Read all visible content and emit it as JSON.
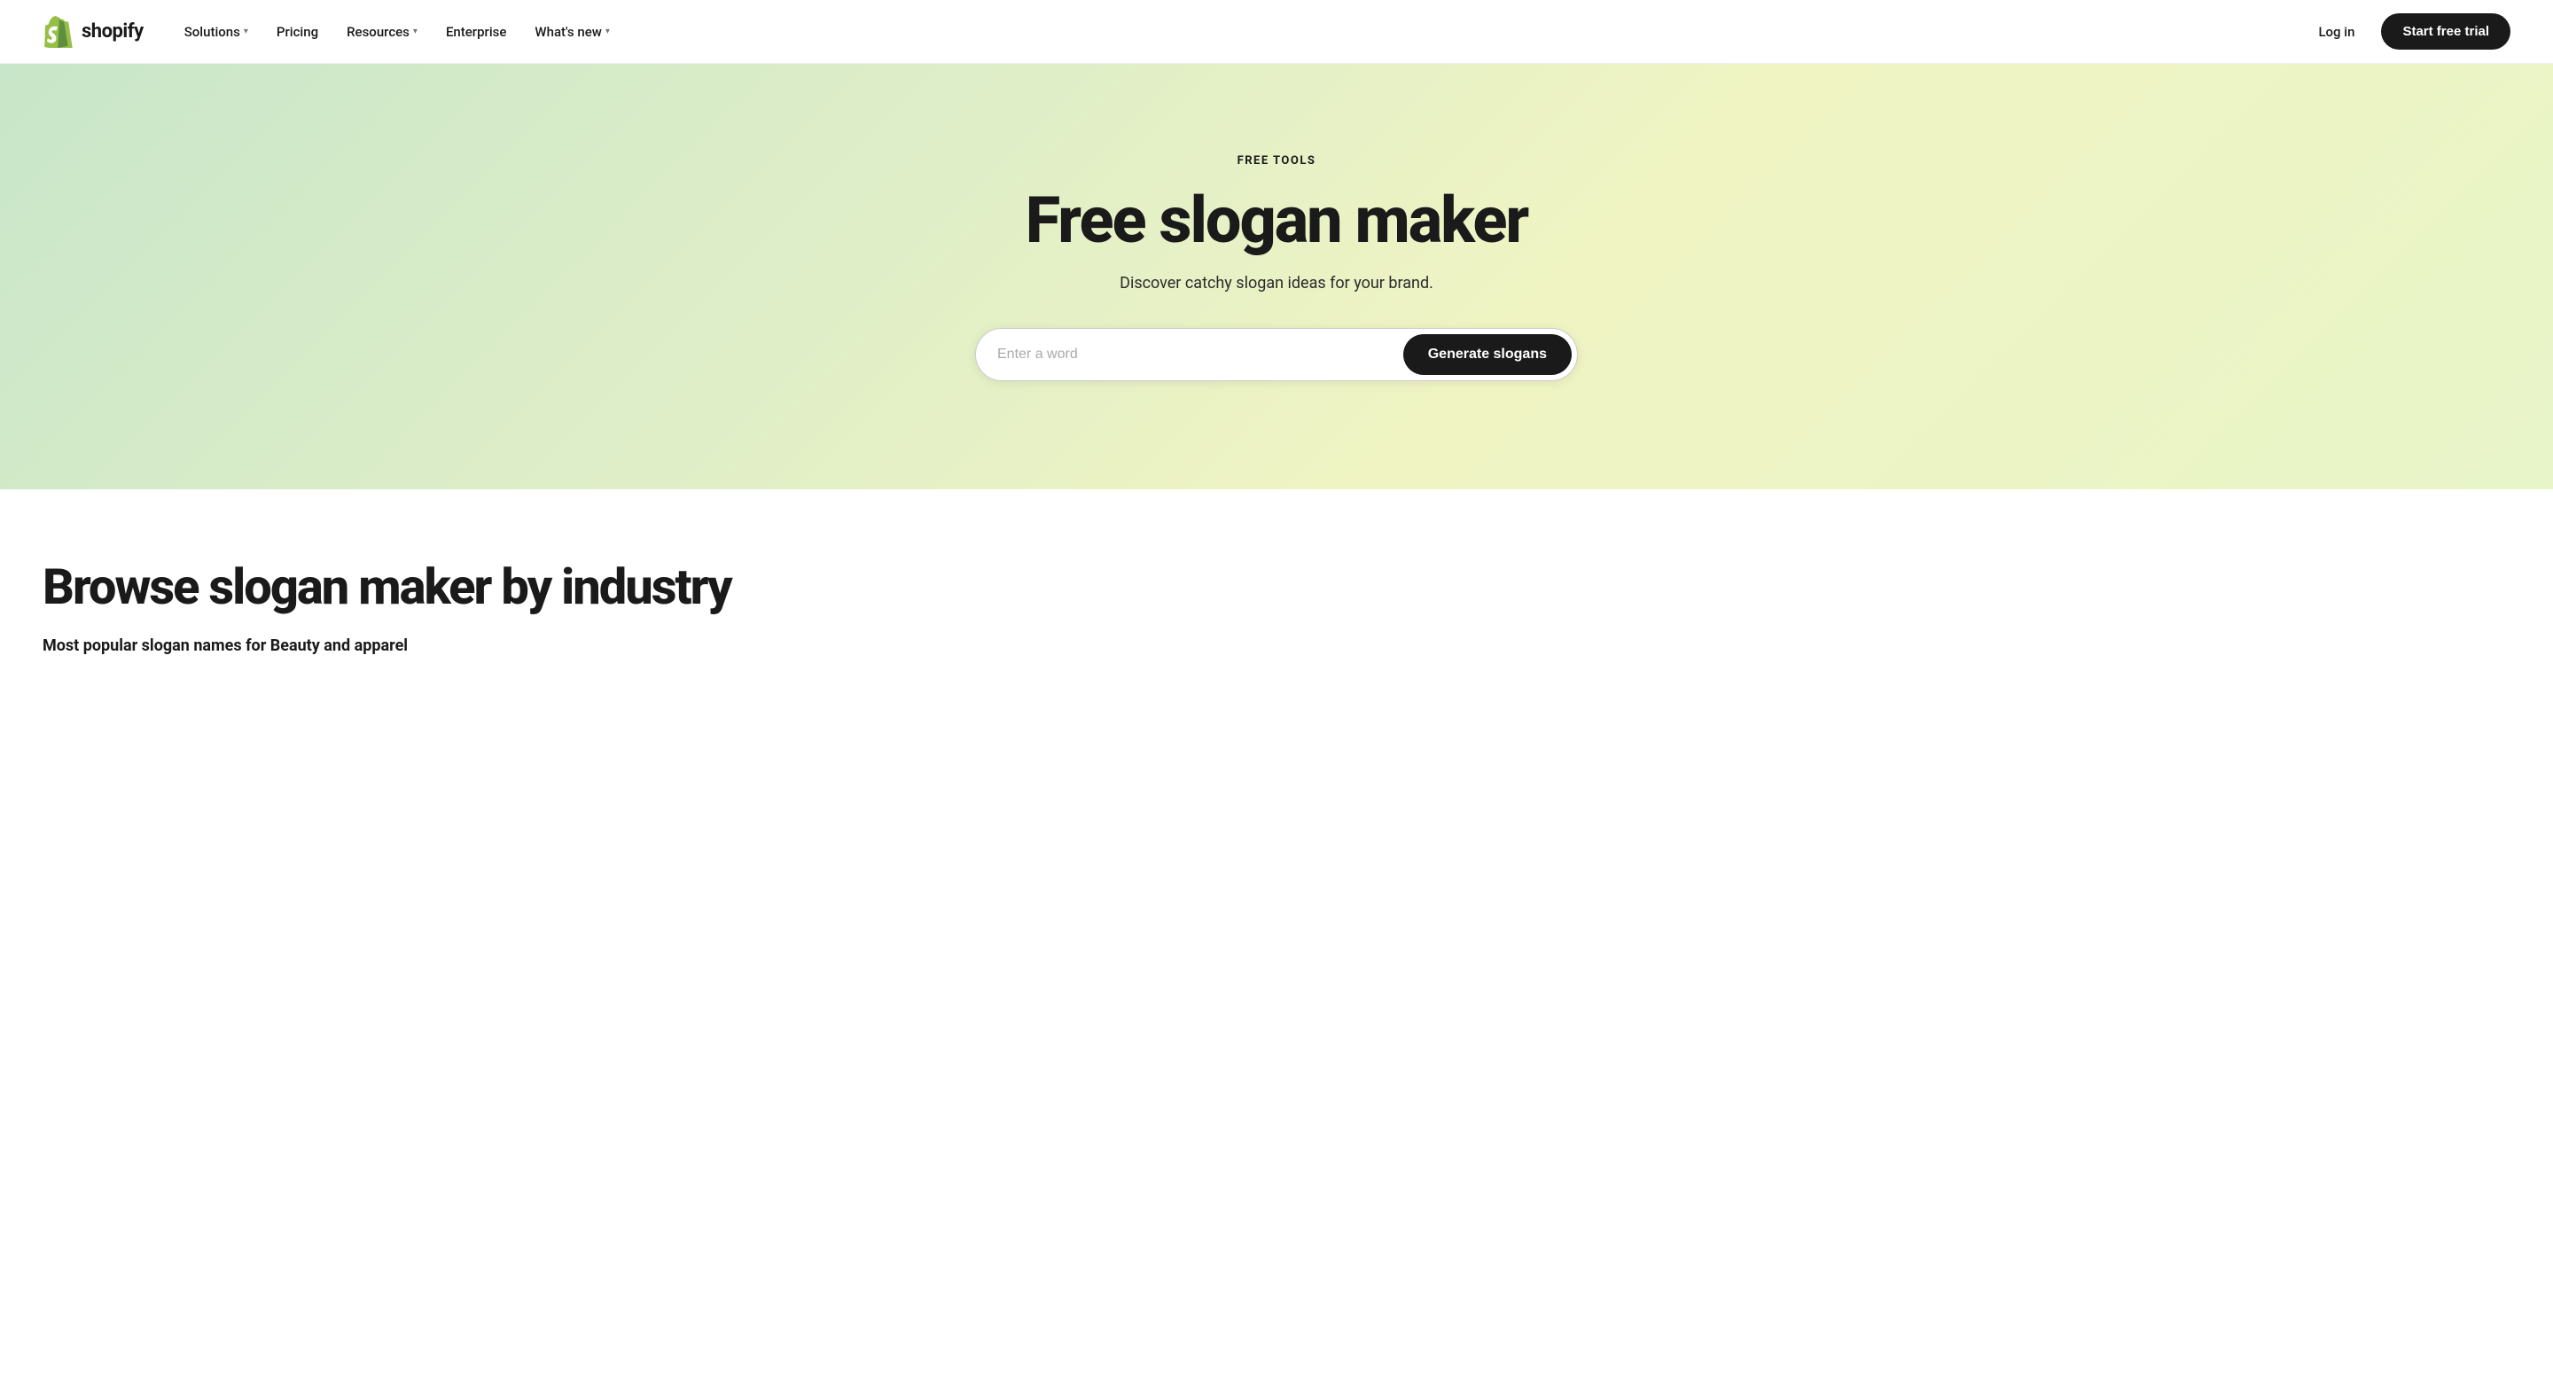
{
  "nav": {
    "logo_text": "shopify",
    "links": [
      {
        "label": "Solutions",
        "has_dropdown": true
      },
      {
        "label": "Pricing",
        "has_dropdown": false
      },
      {
        "label": "Resources",
        "has_dropdown": true
      },
      {
        "label": "Enterprise",
        "has_dropdown": false
      },
      {
        "label": "What's new",
        "has_dropdown": true
      }
    ],
    "login_label": "Log in",
    "cta_label": "Start free trial"
  },
  "hero": {
    "eyebrow": "FREE TOOLS",
    "title": "Free slogan maker",
    "subtitle": "Discover catchy slogan ideas for your brand.",
    "input_placeholder": "Enter a word",
    "button_label": "Generate slogans"
  },
  "browse": {
    "title": "Browse slogan maker by industry",
    "subtitle": "Most popular slogan names for Beauty and apparel"
  }
}
